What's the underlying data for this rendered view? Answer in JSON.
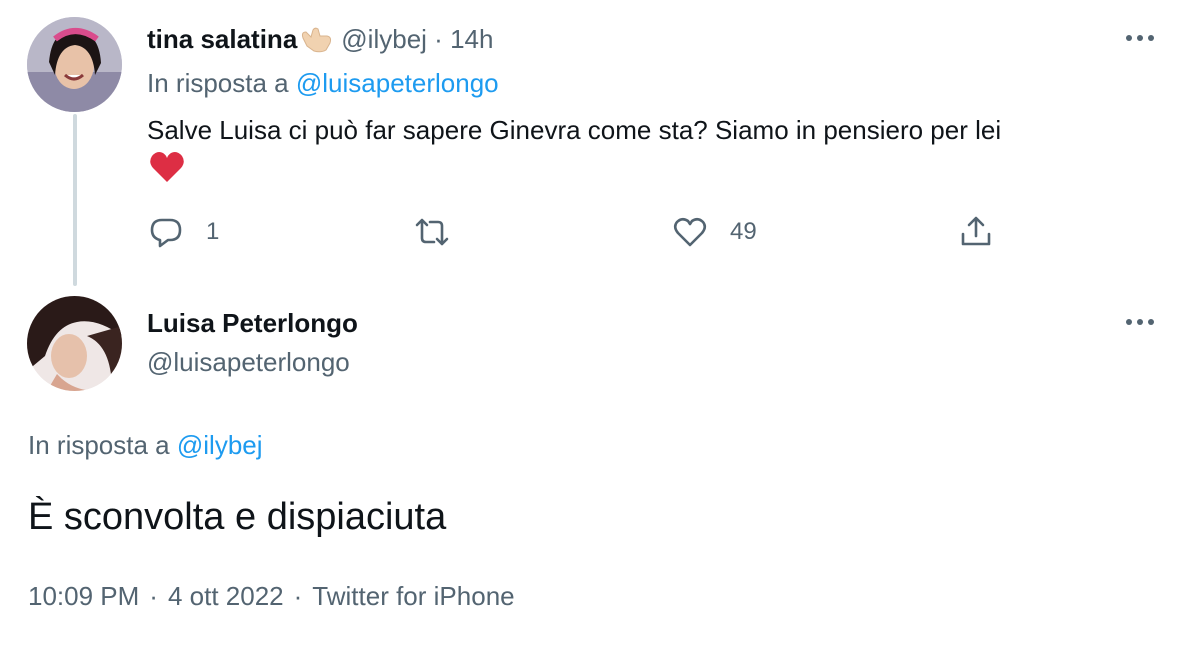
{
  "reply_tweet": {
    "display_name": "tina salatina",
    "name_emoji": "call-me-hand-emoji",
    "handle": "@ilybej",
    "separator": "·",
    "time": "14h",
    "reply_prefix": "In risposta a",
    "reply_to": "@luisapeterlongo",
    "text": "Salve Luisa ci può far sapere Ginevra come sta? Siamo in pensiero per lei",
    "text_emoji": "red-heart-emoji",
    "actions": {
      "reply_count": "1",
      "retweet_count": "",
      "like_count": "49"
    }
  },
  "main_tweet": {
    "display_name": "Luisa Peterlongo",
    "handle": "@luisapeterlongo",
    "reply_prefix": "In risposta a",
    "reply_to": "@ilybej",
    "text": "È sconvolta e dispiaciuta",
    "time": "10:09 PM",
    "separator": "·",
    "date": "4 ott 2022",
    "source": "Twitter for iPhone"
  },
  "icons": {
    "more": "more-horizontal-icon",
    "reply": "reply-bubble-icon",
    "retweet": "retweet-icon",
    "like": "heart-outline-icon",
    "share": "share-upload-icon"
  },
  "colors": {
    "text_primary": "#0f1419",
    "text_secondary": "#536471",
    "link": "#1d9bf0",
    "thread_line": "#cfd9de",
    "heart_red": "#dd2e44"
  }
}
